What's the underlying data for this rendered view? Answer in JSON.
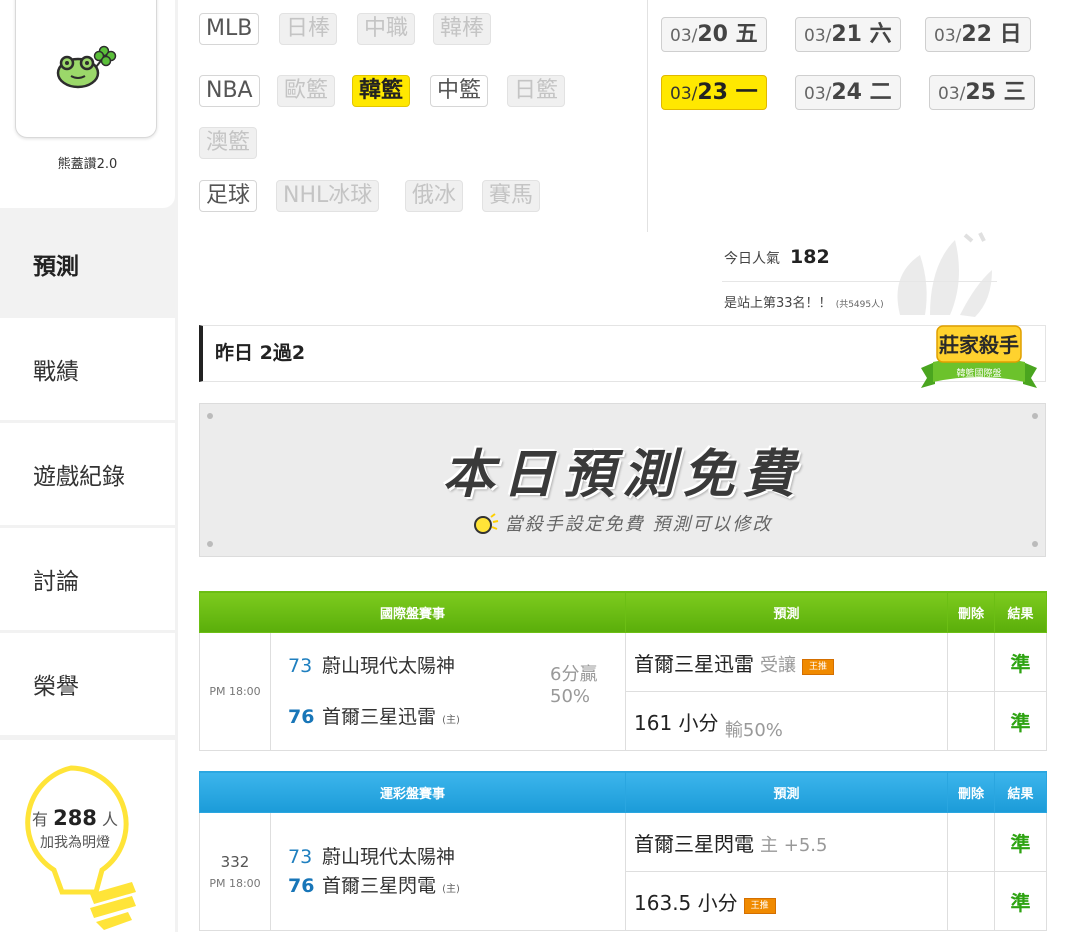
{
  "sidebar": {
    "profile_name": "熊蓋讚2.0",
    "nav": [
      "預測",
      "戰績",
      "遊戲紀錄",
      "討論",
      "榮譽"
    ],
    "fans": {
      "prefix": "有",
      "count": "288",
      "suffix": "人",
      "line2": "加我為明燈"
    }
  },
  "tags": {
    "row1": [
      "MLB",
      "日棒",
      "中職",
      "韓棒"
    ],
    "row2": [
      "NBA",
      "歐籃",
      "韓籃",
      "中籃",
      "日籃"
    ],
    "row3": [
      "澳籃"
    ],
    "row4": [
      "足球",
      "NHL冰球",
      "俄冰",
      "賽馬"
    ]
  },
  "dates": [
    {
      "md": "03/",
      "d": "20 五"
    },
    {
      "md": "03/",
      "d": "21 六"
    },
    {
      "md": "03/",
      "d": "22 日"
    },
    {
      "md": "03/",
      "d": "23 一"
    },
    {
      "md": "03/",
      "d": "24 二"
    },
    {
      "md": "03/",
      "d": "25 三"
    }
  ],
  "popularity": {
    "label": "今日人氣",
    "value": "182",
    "rank": "是站上第33名！！",
    "total": "(共5495人)"
  },
  "record": {
    "text": "昨日 2過2"
  },
  "badge": {
    "title": "莊家殺手",
    "sub": "韓籃國際盤"
  },
  "banner": {
    "title": "本日預測免費",
    "sub": "當殺手設定免費 預測可以修改"
  },
  "table_intl": {
    "headers": [
      "國際盤賽事",
      "預測",
      "刪除",
      "結果"
    ],
    "time": "PM 18:00",
    "away": {
      "score": "73",
      "team": "蔚山現代太陽神"
    },
    "home": {
      "score": "76",
      "team": "首爾三星迅雷",
      "mark": "(主)"
    },
    "handicap": [
      "6分贏",
      "50%"
    ],
    "pred1": {
      "main": "首爾三星迅雷",
      "note": "受讓",
      "badge": "王推"
    },
    "pred2": {
      "main": "161 小分",
      "note": "輸50%"
    },
    "results": [
      "準",
      "準"
    ]
  },
  "table_sport": {
    "headers": [
      "運彩盤賽事",
      "預測",
      "刪除",
      "結果"
    ],
    "game_no": "332",
    "time": "PM 18:00",
    "away": {
      "score": "73",
      "team": "蔚山現代太陽神"
    },
    "home": {
      "score": "76",
      "team": "首爾三星閃電",
      "mark": "(主)"
    },
    "pred1": {
      "main": "首爾三星閃電",
      "note": "主 +5.5"
    },
    "pred2": {
      "main": "163.5 小分",
      "badge": "王推"
    },
    "results": [
      "準",
      "準"
    ]
  },
  "colors": {
    "highlight": "#ffe800",
    "green_header": "#5aae0a",
    "blue_header": "#1b9bd8",
    "win_green": "#2ea312"
  }
}
